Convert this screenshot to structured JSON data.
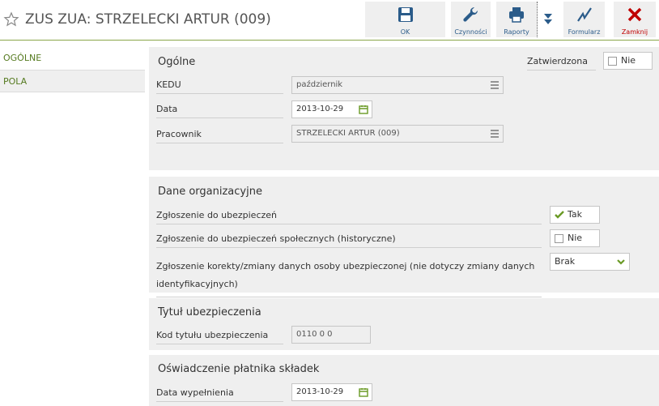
{
  "header": {
    "title": "ZUS ZUA: STRZELECKI ARTUR (009)",
    "toolbar": {
      "ok": "OK",
      "czynnosci": "Czynności",
      "raporty": "Raporty",
      "formularz": "Formularz",
      "zamknij": "Zamknij"
    }
  },
  "nav": {
    "items": [
      {
        "label": "OGÓLNE"
      },
      {
        "label": "POLA"
      }
    ]
  },
  "ogolne": {
    "title": "Ogólne",
    "zatwierdzona_label": "Zatwierdzona",
    "zatwierdzona_value": "Nie",
    "kedu_label": "KEDU",
    "kedu_value": "październik",
    "data_label": "Data",
    "data_value": "2013-10-29",
    "pracownik_label": "Pracownik",
    "pracownik_value": "STRZELECKI ARTUR (009)"
  },
  "dane": {
    "title": "Dane organizacyjne",
    "zgl_label": "Zgłoszenie do ubezpieczeń",
    "zgl_value": "Tak",
    "zgl_hist_label": "Zgłoszenie do ubezpieczeń społecznych (historyczne)",
    "zgl_hist_value": "Nie",
    "korekta_label_1": "Zgłoszenie korekty/zmiany danych osoby ubezpieczonej (nie dotyczy zmiany danych",
    "korekta_label_2": "identyfikacyjnych)",
    "korekta_value": "Brak"
  },
  "tytul": {
    "title": "Tytuł ubezpieczenia",
    "kod_label": "Kod tytułu ubezpieczenia",
    "kod_value": "0110 0 0"
  },
  "oswiadczenie": {
    "title": "Oświadczenie płatnika składek",
    "data_label": "Data wypełnienia",
    "data_value": "2013-10-29"
  },
  "colors": {
    "accent": "#557a1f",
    "link": "#2b5c8a",
    "close": "#c00000",
    "section_bg": "#efefef"
  },
  "icons": [
    "star-icon",
    "save-icon",
    "wrench-icon",
    "printer-icon",
    "chevron-down-icon",
    "signature-icon",
    "close-icon",
    "list-icon",
    "calendar-icon",
    "check-icon",
    "chevron-down-icon"
  ]
}
